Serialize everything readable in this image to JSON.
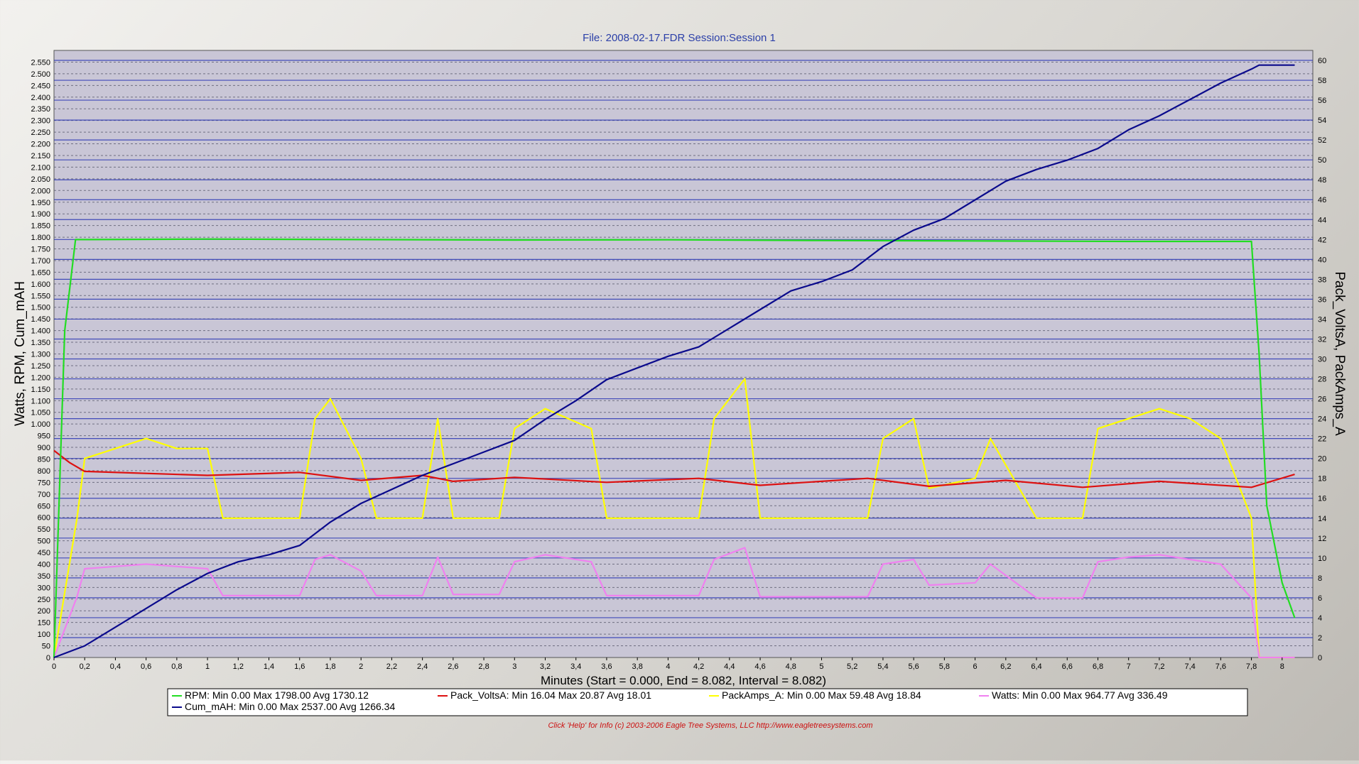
{
  "chart_data": {
    "type": "line",
    "title": "File: 2008-02-17.FDR   Session:Session 1",
    "xlabel": "Minutes (Start = 0.000,  End = 8.082,  Interval =  8.082)",
    "ylabel_left": "Watts, RPM, Cum_mAH",
    "ylabel_right": "Pack_VoltsA, PackAmps_A",
    "xlim": [
      0,
      8.2
    ],
    "ylim_left": [
      0,
      2600
    ],
    "ylim_right": [
      0,
      61
    ],
    "x_ticks": [
      "0",
      "0,2",
      "0,4",
      "0,6",
      "0,8",
      "1",
      "1,2",
      "1,4",
      "1,6",
      "1,8",
      "2",
      "2,2",
      "2,4",
      "2,6",
      "2,8",
      "3",
      "3,2",
      "3,4",
      "3,6",
      "3,8",
      "4",
      "4,2",
      "4,4",
      "4,6",
      "4,8",
      "5",
      "5,2",
      "5,4",
      "5,6",
      "5,8",
      "6",
      "6,2",
      "6,4",
      "6,6",
      "6,8",
      "7",
      "7,2",
      "7,4",
      "7,6",
      "7,8",
      "8"
    ],
    "y_left_ticks": [
      "0",
      "50",
      "100",
      "150",
      "200",
      "250",
      "300",
      "350",
      "400",
      "450",
      "500",
      "550",
      "600",
      "650",
      "700",
      "750",
      "800",
      "850",
      "900",
      "950",
      "1.000",
      "1.050",
      "1.100",
      "1.150",
      "1.200",
      "1.250",
      "1.300",
      "1.350",
      "1.400",
      "1.450",
      "1.500",
      "1.550",
      "1.600",
      "1.650",
      "1.700",
      "1.750",
      "1.800",
      "1.850",
      "1.900",
      "1.950",
      "2.000",
      "2.050",
      "2.100",
      "2.150",
      "2.200",
      "2.250",
      "2.300",
      "2.350",
      "2.400",
      "2.450",
      "2.500",
      "2.550"
    ],
    "y_right_ticks": [
      "0",
      "2",
      "4",
      "6",
      "8",
      "10",
      "12",
      "14",
      "16",
      "18",
      "20",
      "22",
      "24",
      "26",
      "28",
      "30",
      "32",
      "34",
      "36",
      "38",
      "40",
      "42",
      "44",
      "46",
      "48",
      "50",
      "52",
      "54",
      "56",
      "58",
      "60"
    ],
    "grid": true,
    "legend_position": "bottom",
    "series": [
      {
        "name": "RPM",
        "axis": "left",
        "color": "#22dd22",
        "legend_stats": "RPM:  Min 0.00    Max 1798.00    Avg 1730.12",
        "x": [
          0,
          0.07,
          0.14,
          0.2,
          1.0,
          2.0,
          3.0,
          4.0,
          5.0,
          6.0,
          7.0,
          7.8,
          7.85,
          7.9,
          8.0,
          8.082
        ],
        "y": [
          0,
          1400,
          1790,
          1790,
          1792,
          1790,
          1788,
          1789,
          1786,
          1784,
          1782,
          1782,
          1300,
          650,
          320,
          170
        ]
      },
      {
        "name": "Pack_VoltsA",
        "axis": "right",
        "color": "#dd1111",
        "legend_stats": "Pack_VoltsA:  Min 16.04    Max 20.87    Avg 18.01",
        "x": [
          0,
          0.1,
          0.2,
          1.0,
          1.6,
          2.0,
          2.4,
          2.6,
          3.0,
          3.6,
          4.2,
          4.6,
          5.3,
          5.7,
          6.2,
          6.7,
          7.2,
          7.8,
          8.082
        ],
        "y": [
          20.8,
          19.6,
          18.7,
          18.3,
          18.6,
          17.8,
          18.3,
          17.7,
          18.1,
          17.6,
          18.0,
          17.3,
          18.0,
          17.2,
          17.8,
          17.1,
          17.7,
          17.1,
          18.4
        ]
      },
      {
        "name": "PackAmps_A",
        "axis": "right",
        "color": "#ffff00",
        "legend_stats": "PackAmps_A:  Min 0.00    Max 59.48    Avg 18.84",
        "x": [
          0,
          0.15,
          0.2,
          0.4,
          0.6,
          0.8,
          1.0,
          1.1,
          1.6,
          1.7,
          1.8,
          2.0,
          2.1,
          2.4,
          2.5,
          2.6,
          2.9,
          3.0,
          3.2,
          3.5,
          3.6,
          4.2,
          4.3,
          4.5,
          4.6,
          5.3,
          5.4,
          5.6,
          5.7,
          6.0,
          6.1,
          6.4,
          6.7,
          6.8,
          7.0,
          7.2,
          7.4,
          7.6,
          7.8,
          7.85,
          8.082
        ],
        "y": [
          0,
          14,
          20,
          21,
          22,
          21,
          21,
          14,
          14,
          24,
          26,
          20,
          14,
          14,
          24,
          14,
          14,
          23,
          25,
          23,
          14,
          14,
          24,
          28,
          14,
          14,
          22,
          24,
          17,
          18,
          22,
          14,
          14,
          23,
          24,
          25,
          24,
          22,
          14,
          0,
          0
        ]
      },
      {
        "name": "Watts",
        "axis": "left",
        "color": "#f080f0",
        "legend_stats": "Watts:  Min 0.00    Max 964.77    Avg 336.49",
        "x": [
          0,
          0.15,
          0.2,
          0.4,
          0.6,
          0.8,
          1.0,
          1.1,
          1.6,
          1.7,
          1.8,
          2.0,
          2.1,
          2.4,
          2.5,
          2.6,
          2.9,
          3.0,
          3.2,
          3.5,
          3.6,
          4.2,
          4.3,
          4.5,
          4.6,
          5.3,
          5.4,
          5.6,
          5.7,
          6.0,
          6.1,
          6.4,
          6.7,
          6.8,
          7.0,
          7.2,
          7.4,
          7.6,
          7.8,
          7.85,
          8.082
        ],
        "y": [
          0,
          260,
          380,
          390,
          400,
          390,
          380,
          265,
          265,
          420,
          440,
          370,
          265,
          265,
          430,
          270,
          270,
          410,
          440,
          410,
          265,
          265,
          420,
          470,
          260,
          260,
          400,
          420,
          310,
          320,
          400,
          255,
          255,
          410,
          430,
          440,
          420,
          400,
          255,
          0,
          0
        ]
      },
      {
        "name": "Cum_mAH",
        "axis": "left",
        "color": "#0a0a8c",
        "legend_stats": "Cum_mAH:  Min 0.00    Max 2537.00    Avg 1266.34",
        "x": [
          0,
          0.2,
          0.4,
          0.6,
          0.8,
          1.0,
          1.2,
          1.4,
          1.6,
          1.8,
          2.0,
          2.2,
          2.4,
          2.6,
          2.8,
          3.0,
          3.2,
          3.4,
          3.6,
          3.8,
          4.0,
          4.2,
          4.4,
          4.6,
          4.8,
          5.0,
          5.2,
          5.4,
          5.6,
          5.8,
          6.0,
          6.2,
          6.4,
          6.6,
          6.8,
          7.0,
          7.2,
          7.4,
          7.6,
          7.8,
          7.85,
          8.082
        ],
        "y": [
          0,
          50,
          130,
          210,
          290,
          360,
          410,
          440,
          480,
          580,
          660,
          720,
          780,
          830,
          880,
          930,
          1020,
          1100,
          1190,
          1240,
          1290,
          1330,
          1410,
          1490,
          1570,
          1610,
          1660,
          1760,
          1830,
          1880,
          1960,
          2040,
          2090,
          2130,
          2180,
          2260,
          2320,
          2390,
          2460,
          2520,
          2537,
          2537
        ]
      }
    ],
    "footer": "Click 'Help' for Info  (c) 2003-2006 Eagle Tree Systems, LLC      http://www.eagletreesystems.com"
  }
}
